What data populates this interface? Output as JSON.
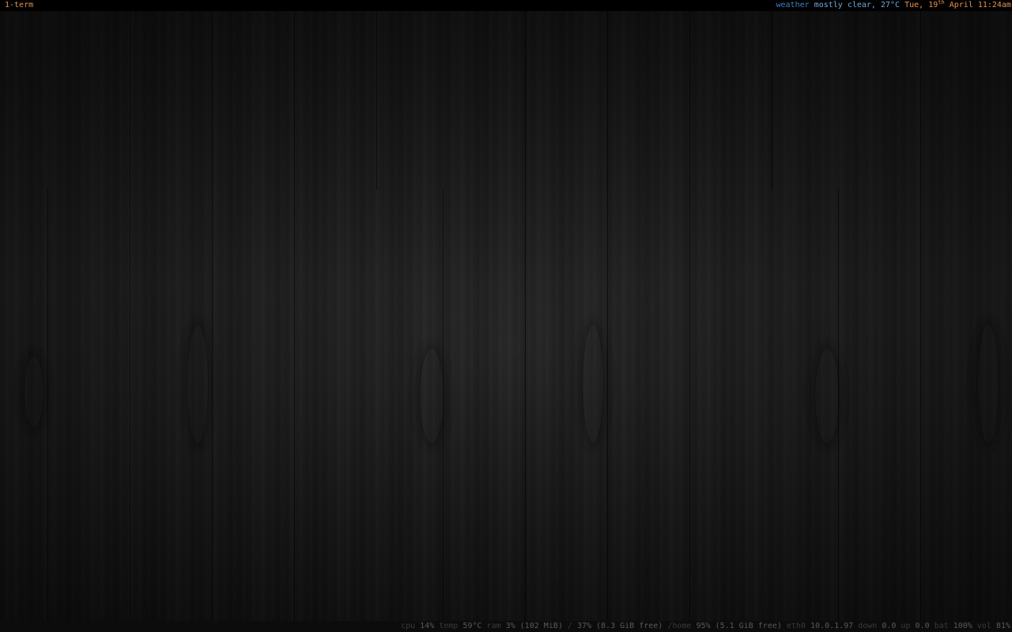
{
  "top_bar": {
    "workspace": "1-term",
    "weather": {
      "label": "weather",
      "value": "mostly clear, 27°C"
    },
    "datetime": {
      "day": "Tue, 19",
      "day_suffix": "th",
      "month_time": "April 11:24am"
    }
  },
  "status_bar": {
    "cpu": {
      "label": "cpu",
      "value": "14%"
    },
    "temp": {
      "label": "temp",
      "value": "59°C"
    },
    "ram": {
      "label": "ram",
      "value": "3% (102 MiB)"
    },
    "root": {
      "label": "/",
      "value": "37% (8.3 GiB free)"
    },
    "home": {
      "label": "/home",
      "value": "95% (5.1 GiB free)"
    },
    "eth": {
      "label": "eth0",
      "value": "10.0.1.97"
    },
    "down": {
      "label": "down",
      "value": "0.0"
    },
    "up": {
      "label": "up",
      "value": "0.0"
    },
    "bat": {
      "label": "bat",
      "value": "100%"
    },
    "vol": {
      "label": "vol",
      "value": "81%"
    }
  },
  "colors": {
    "accent_orange": "#e8904a",
    "weather_key": "#3f7fc4",
    "weather_value": "#6fa6dc",
    "status_key": "#3a3a3a",
    "status_value": "#595959"
  }
}
